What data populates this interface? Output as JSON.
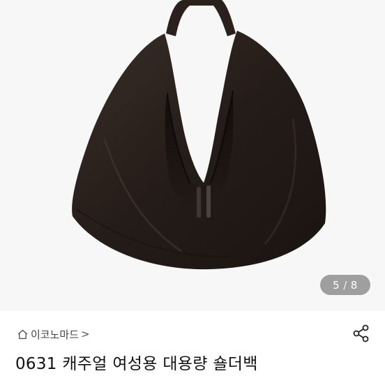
{
  "image_counter": {
    "current": "5",
    "separator": "/",
    "total": "8"
  },
  "shop": {
    "name": "이코노마드",
    "chevron": ">",
    "icon": "home-icon"
  },
  "share": {
    "icon": "share-icon"
  },
  "product": {
    "title": "0631 캐주얼 여성용 대용량 숄더백"
  },
  "colors": {
    "bag": "#2a211d",
    "background": "#f7f7f7",
    "counter_bg": "#6a6a6a"
  }
}
